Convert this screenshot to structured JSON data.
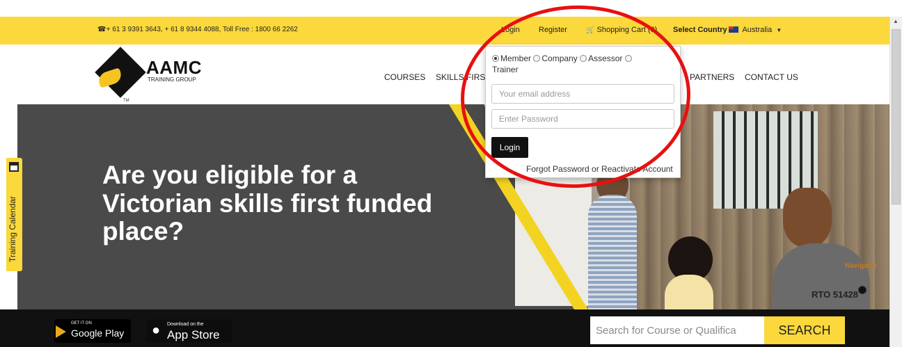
{
  "topbar": {
    "phone_icon": "phone-icon",
    "phone_text": "+ 61 3 9391 3643, + 61 8 9344 4088, Toll Free : 1800 66 2262",
    "login": "Login",
    "register": "Register",
    "cart_icon": "cart-icon",
    "cart_label": "Shopping Cart (0)",
    "select_country_label": "Select Country :",
    "country": "Australia",
    "background_color": "#fbd83b"
  },
  "logo": {
    "name": "AAMC",
    "subtitle": "TRAINING GROUP",
    "tm": "TM"
  },
  "nav": {
    "items": [
      "COURSES",
      "SKILLS FIRST",
      "PARTNERS",
      "CONTACT US"
    ]
  },
  "login_popup": {
    "roles": [
      "Member",
      "Company",
      "Assessor",
      "Trainer"
    ],
    "selected_role": "Member",
    "email_placeholder": "Your email address",
    "password_placeholder": "Enter Password",
    "login_button": "Login",
    "forgot_link": "Forgot Password or Reactivate Account"
  },
  "hero": {
    "headline": "Are you eligible for a Victorian skills first funded place?",
    "rto": "RTO 51428",
    "navigator_label": "Navigator",
    "slide_count": 3,
    "active_slide": 1
  },
  "training_calendar": {
    "label": "Training Calendar",
    "icon": "calendar-icon"
  },
  "bottombar": {
    "google_play_small": "GET IT ON",
    "google_play_big": "Google Play",
    "app_store_small": "Download on the",
    "app_store_big": "App Store",
    "search_placeholder": "Search for Course or Qualifica",
    "search_button": "SEARCH",
    "accent_color": "#fbd83b"
  },
  "annotation": {
    "color": "#e81010"
  }
}
